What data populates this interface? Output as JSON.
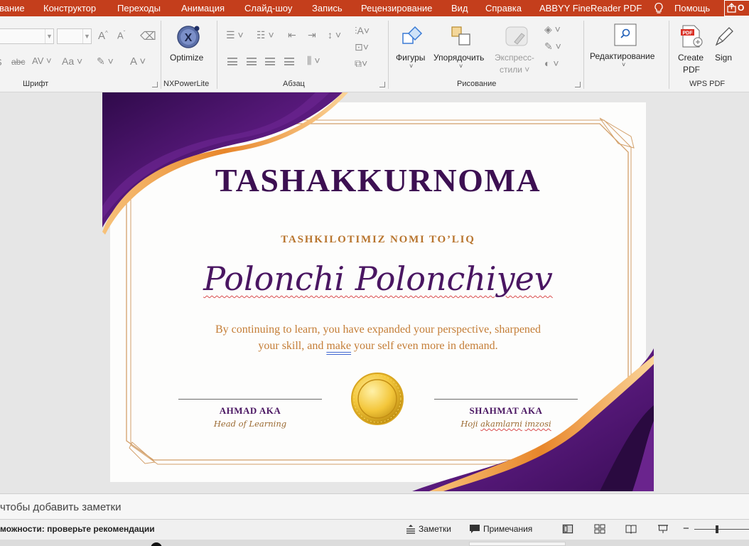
{
  "tabs": [
    "вание",
    "Конструктор",
    "Переходы",
    "Анимация",
    "Слайд-шоу",
    "Запись",
    "Рецензирование",
    "Вид",
    "Справка",
    "ABBYY FineReader PDF",
    "Помощь"
  ],
  "ribbon": {
    "groups": {
      "font": "Шрифт",
      "nxpowerlite": "NXPowerLite",
      "paragraph": "Абзац",
      "drawing": "Рисование",
      "wps_pdf": "WPS PDF"
    },
    "buttons": {
      "optimize": "Optimize",
      "shapes": "Фигуры",
      "arrange": "Упорядочить",
      "quick_styles_1": "Экспресс-",
      "quick_styles_2": "стили",
      "editing": "Редактирование",
      "create_pdf_1": "Create",
      "create_pdf_2": "PDF",
      "sign": "Sign"
    },
    "font_glyphs": {
      "abc": "abc",
      "av": "AV",
      "aa": "Aa",
      "a": "A"
    }
  },
  "slide": {
    "title": "TASHAKKURNOMA",
    "organization": "TASHKILOTIMIZ NOMI TO’LIQ",
    "recipient": "Polonchi Polonchiyev",
    "body_line1": "By continuing to learn, you have expanded your perspective, sharpened",
    "body_line2_pre": "your skill, and ",
    "body_line2_mark": "make",
    "body_line2_post": " your self even more in demand.",
    "signer_left": {
      "name": "AHMAD AKA",
      "role": "Head of Learning"
    },
    "signer_right": {
      "name": "SHAHMAT AKA",
      "role_pre": "Hoji ",
      "role_mark1": "akamlarni",
      "role_space": " ",
      "role_mark2": "imzosi"
    }
  },
  "notes_placeholder": "чтобы добавить заметки",
  "status": {
    "accessibility": "можности: проверьте рекомендации",
    "notes": "Заметки",
    "comments": "Примечания",
    "zoom_minus": "−"
  },
  "colors": {
    "tab_bar": "#c43e1c",
    "ribbon_bg": "#f3f3f3",
    "title": "#3d1052",
    "accent_gold": "#b8752e",
    "purple_ribbon": "#4b1469",
    "orange_ribbon": "#e8963a"
  },
  "icons": [
    "lightbulb-icon",
    "share-icon",
    "optimize-icon",
    "shapes-icon",
    "arrange-icon",
    "quick-styles-icon",
    "find-icon",
    "create-pdf-icon",
    "sign-icon",
    "notes-icon",
    "comments-icon",
    "normal-view-icon",
    "slide-sorter-icon",
    "reading-view-icon",
    "slideshow-icon"
  ]
}
